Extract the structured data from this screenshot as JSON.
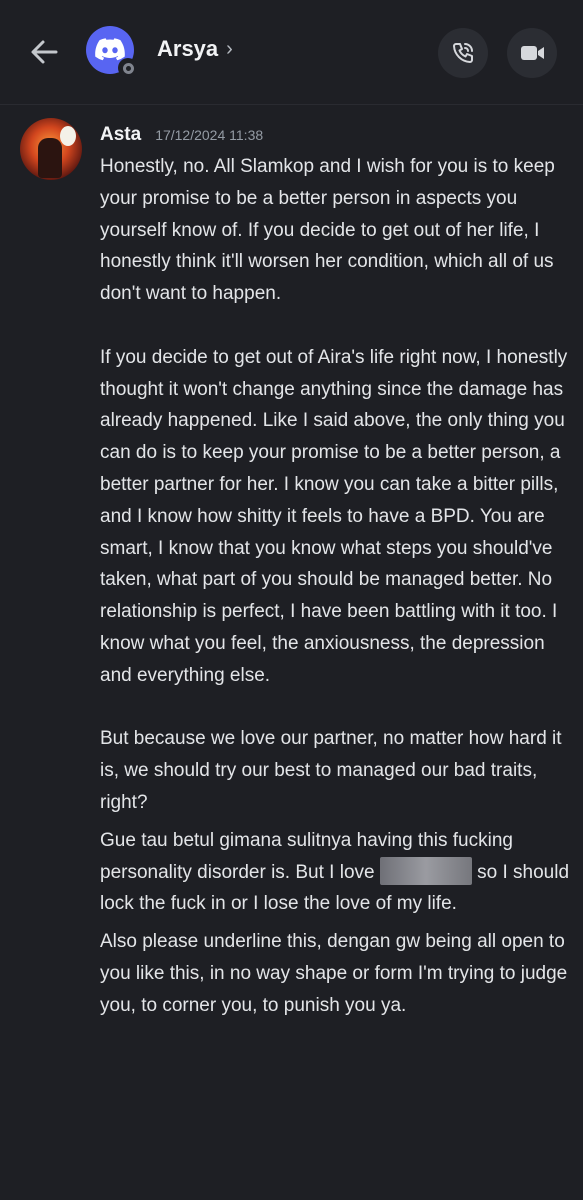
{
  "header": {
    "title": "Arsya",
    "title_chevron": "›",
    "back_icon": "arrow-left-icon",
    "avatar_icon": "discord-logo-icon",
    "status": "offline",
    "call_icon": "phone-call-icon",
    "video_icon": "video-camera-icon"
  },
  "message": {
    "author": "Asta",
    "timestamp": "17/12/2024 11:38",
    "paragraph1": "Honestly, no. All Slamkop and I wish for you is to keep your promise to be a better person in aspects you yourself know of. If you decide to get out of her life, I honestly think it'll worsen her condition, which all of us don't want to happen.",
    "paragraph2": "If you decide to get out of Aira's life right now, I honestly thought it won't change anything since the damage has already happened. Like I said above, the only thing you can do is to keep your promise to be a better person, a better partner for her. I know you can take a bitter pills, and I know how shitty it feels to have a BPD. You are smart, I know that you know what steps you should've taken, what part of you should be managed better. No relationship is perfect, I have been battling with it too. I know what you feel, the anxiousness, the depression and everything else.",
    "paragraph3": "But because we love our partner, no matter how hard it is, we should try our best to managed our bad traits, right?",
    "message2_before": "Gue tau betul gimana sulitnya having this fucking personality disorder is. But I love ",
    "message2_after": " so I should lock the fuck in or I lose the love of my life.",
    "message3": "Also please underline this, dengan gw being all open to you like this, in no way shape or form I'm trying to judge you, to corner you, to punish you ya."
  }
}
